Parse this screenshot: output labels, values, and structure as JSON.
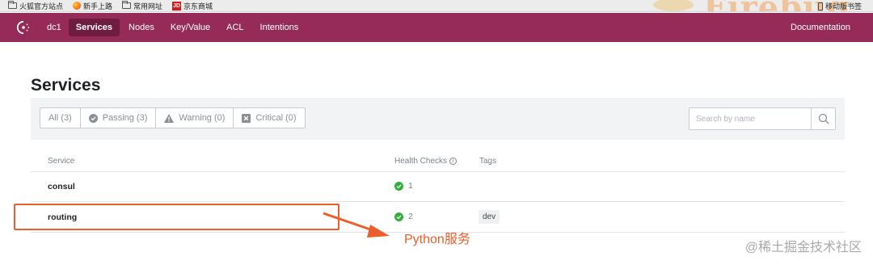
{
  "browser": {
    "bookmarks": [
      {
        "label": "火狐官方站点",
        "icon": "folder-icon"
      },
      {
        "label": "新手上路",
        "icon": "firefox-icon"
      },
      {
        "label": "常用网址",
        "icon": "folder-icon"
      },
      {
        "label": "京东商城",
        "icon": "jd-icon"
      }
    ],
    "jd_badge": "JD",
    "banner_text": "Firebug",
    "mobile_bookmarks": "移动版书签"
  },
  "nav": {
    "datacenter": "dc1",
    "items": [
      "Services",
      "Nodes",
      "Key/Value",
      "ACL",
      "Intentions"
    ],
    "active": "Services",
    "documentation": "Documentation"
  },
  "page": {
    "title": "Services",
    "filters": [
      {
        "label": "All (3)",
        "icon": ""
      },
      {
        "label": "Passing (3)",
        "icon": "check-circle-icon"
      },
      {
        "label": "Warning (0)",
        "icon": "warning-triangle-icon"
      },
      {
        "label": "Critical (0)",
        "icon": "x-square-icon"
      }
    ],
    "search_placeholder": "Search by name"
  },
  "table": {
    "headers": {
      "service": "Service",
      "health": "Health Checks",
      "tags": "Tags"
    },
    "info_glyph": "i",
    "rows": [
      {
        "name": "consul",
        "checks": "1",
        "tags": []
      },
      {
        "name": "routing",
        "checks": "2",
        "tags": [
          "dev"
        ]
      }
    ]
  },
  "annotation": {
    "text": "Python服务"
  },
  "watermark": "@稀土掘金技术社区",
  "colors": {
    "brand": "#962b5a",
    "brand_active": "#6e1c40",
    "passing": "#2eb039",
    "annotation": "#ee5e2a"
  }
}
